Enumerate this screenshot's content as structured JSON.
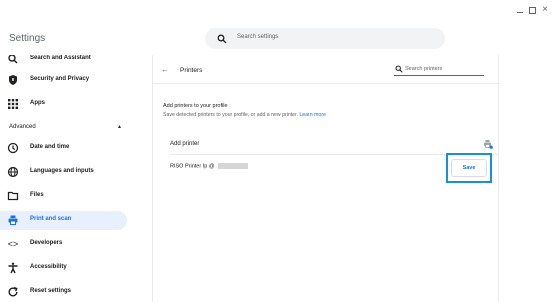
{
  "window": {
    "controls": {
      "minimize_icon": "minimize-icon",
      "maximize_icon": "maximize-icon",
      "close_label": "×"
    }
  },
  "header": {
    "title": "Settings",
    "search": {
      "placeholder": "Search settings"
    }
  },
  "sidebar": {
    "items_top": [
      {
        "label": "Search and Assistant",
        "icon": "search-icon"
      },
      {
        "label": "Security and Privacy",
        "icon": "shield-icon"
      },
      {
        "label": "Apps",
        "icon": "apps-grid-icon"
      }
    ],
    "advanced": {
      "label": "Advanced",
      "caret": "▲"
    },
    "items_advanced": [
      {
        "label": "Date and time",
        "icon": "clock-icon"
      },
      {
        "label": "Languages and inputs",
        "icon": "globe-icon"
      },
      {
        "label": "Files",
        "icon": "folder-icon"
      },
      {
        "label": "Print and scan",
        "icon": "printer-icon",
        "active": true
      },
      {
        "label": "Developers",
        "icon": "code-icon"
      },
      {
        "label": "Accessibility",
        "icon": "accessibility-icon"
      },
      {
        "label": "Reset settings",
        "icon": "reset-icon"
      }
    ]
  },
  "main": {
    "page_title": "Printers",
    "printer_search": {
      "placeholder": "Search printers"
    },
    "add_section": {
      "title": "Add printers to your profile",
      "description": "Save detected printers to your profile, or add a new printer.",
      "learn_more": "Learn more"
    },
    "add_printer_label": "Add printer",
    "detected_printer": {
      "name": "RISO Printer Ip @"
    },
    "save_button": "Save"
  },
  "colors": {
    "accent": "#1a73e8",
    "active_bg": "#e8f0fe",
    "highlight": "#1a90d4"
  }
}
